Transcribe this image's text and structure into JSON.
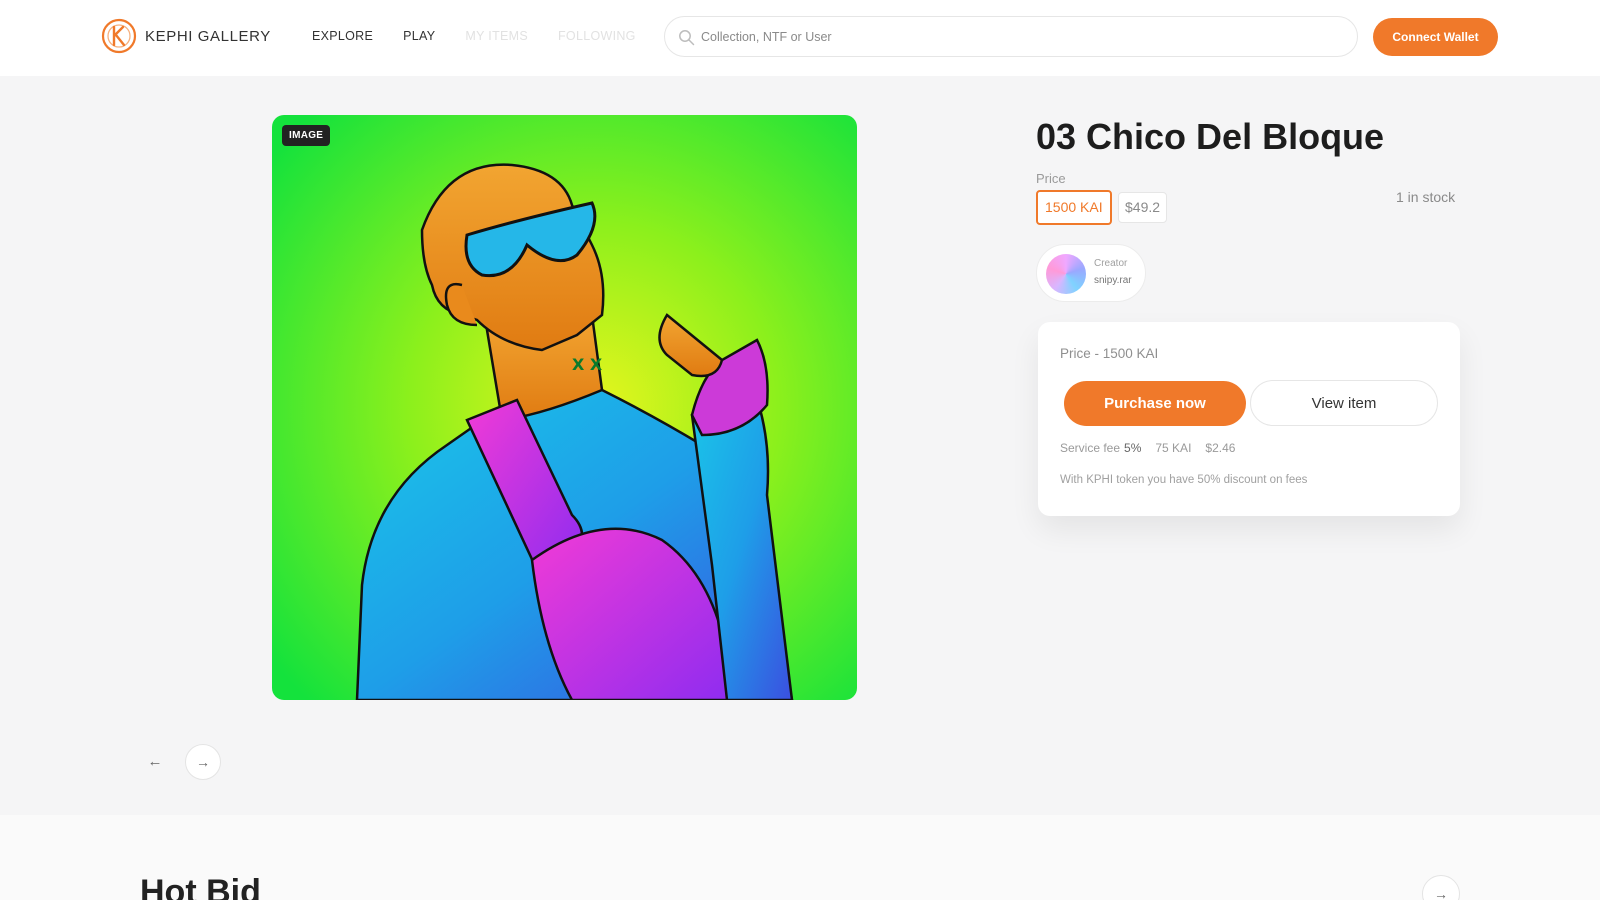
{
  "header": {
    "brand": "KEPHI GALLERY",
    "nav": [
      {
        "label": "EXPLORE"
      },
      {
        "label": "PLAY"
      },
      {
        "label": "MY ITEMS"
      },
      {
        "label": "FOLLOWING"
      }
    ],
    "search": {
      "placeholder": "Collection, NTF or User",
      "value": ""
    },
    "connect_label": "Connect Wallet"
  },
  "item": {
    "media_tag": "IMAGE",
    "title": "03 Chico Del Bloque",
    "price_label": "Price",
    "price_kai": "1500 KAI",
    "price_usd": "$49.2",
    "stock": "1 in stock",
    "creator_label": "Creator",
    "creator_name": "snipy.rar"
  },
  "purchase": {
    "price_text": "Price - 1500 KAI",
    "purchase_label": "Purchase now",
    "view_label": "View item",
    "service_fee_label": "Service fee",
    "service_fee_pct": "5%",
    "fee_kai": "75 KAI",
    "fee_usd": "$2.46",
    "discount_note": "With KPHI token you have 50% discount on fees"
  },
  "carousel": {
    "prev_icon": "arrow-left-icon",
    "next_icon": "arrow-right-icon"
  },
  "hot_bid": {
    "title": "Hot Bid"
  },
  "colors": {
    "accent": "#f0792a",
    "background": "#f5f5f6"
  }
}
